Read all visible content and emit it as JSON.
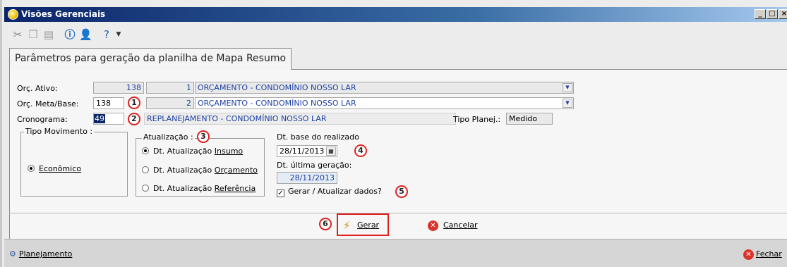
{
  "window": {
    "title": "Visões Gerenciais",
    "buttons": [
      "_",
      "□",
      "×"
    ]
  },
  "toolbar": {
    "icons": [
      "cut-icon",
      "copy-icon",
      "paste-icon",
      "info-icon",
      "user-icon",
      "help-icon",
      "dropdown-arrow-icon"
    ]
  },
  "tab": {
    "label": "Parâmetros para geração da planilha de Mapa Resumo"
  },
  "form": {
    "orc_ativo": {
      "label": "Orç. Ativo:",
      "code": "138",
      "seq": "1",
      "name": "ORÇAMENTO - CONDOMÍNIO NOSSO LAR"
    },
    "orc_meta": {
      "label": "Orç. Meta/Base:",
      "code": "138",
      "seq": "2",
      "name": "ORÇAMENTO - CONDOMÍNIO NOSSO LAR"
    },
    "cronograma": {
      "label": "Cronograma:",
      "code": "49",
      "name": "REPLANEJAMENTO - CONDOMÍNIO NOSSO LAR"
    },
    "tipo_planej": {
      "label": "Tipo Planej.:",
      "value": "Medido"
    },
    "tipo_movimento": {
      "title": "Tipo Movimento :",
      "option": "Econômico"
    },
    "atualizacao": {
      "title": "Atualização :",
      "options": [
        {
          "prefix": "Dt. Atualização ",
          "key": "Insumo"
        },
        {
          "prefix": "Dt. Atualização ",
          "key": "Orçamento"
        },
        {
          "prefix": "Dt. Atualização ",
          "key": "Referência"
        }
      ]
    },
    "dt_base": {
      "label": "Dt. base do realizado",
      "value": "28/11/2013"
    },
    "dt_ultima": {
      "label": "Dt. última geração:",
      "value": "28/11/2013"
    },
    "gerar_dados": {
      "label": "Gerar / Atualizar dados?",
      "checked": true
    }
  },
  "callouts": [
    "1",
    "2",
    "3",
    "4",
    "5",
    "6"
  ],
  "buttons": {
    "gerar": "Gerar",
    "cancelar": "Cancelar"
  },
  "statusbar": {
    "left": "Planejamento",
    "right": "Fechar"
  },
  "colors": {
    "title_gradient_start": "#0a246a",
    "callout_red": "#e02020",
    "value_blue": "#1c3fa0"
  }
}
